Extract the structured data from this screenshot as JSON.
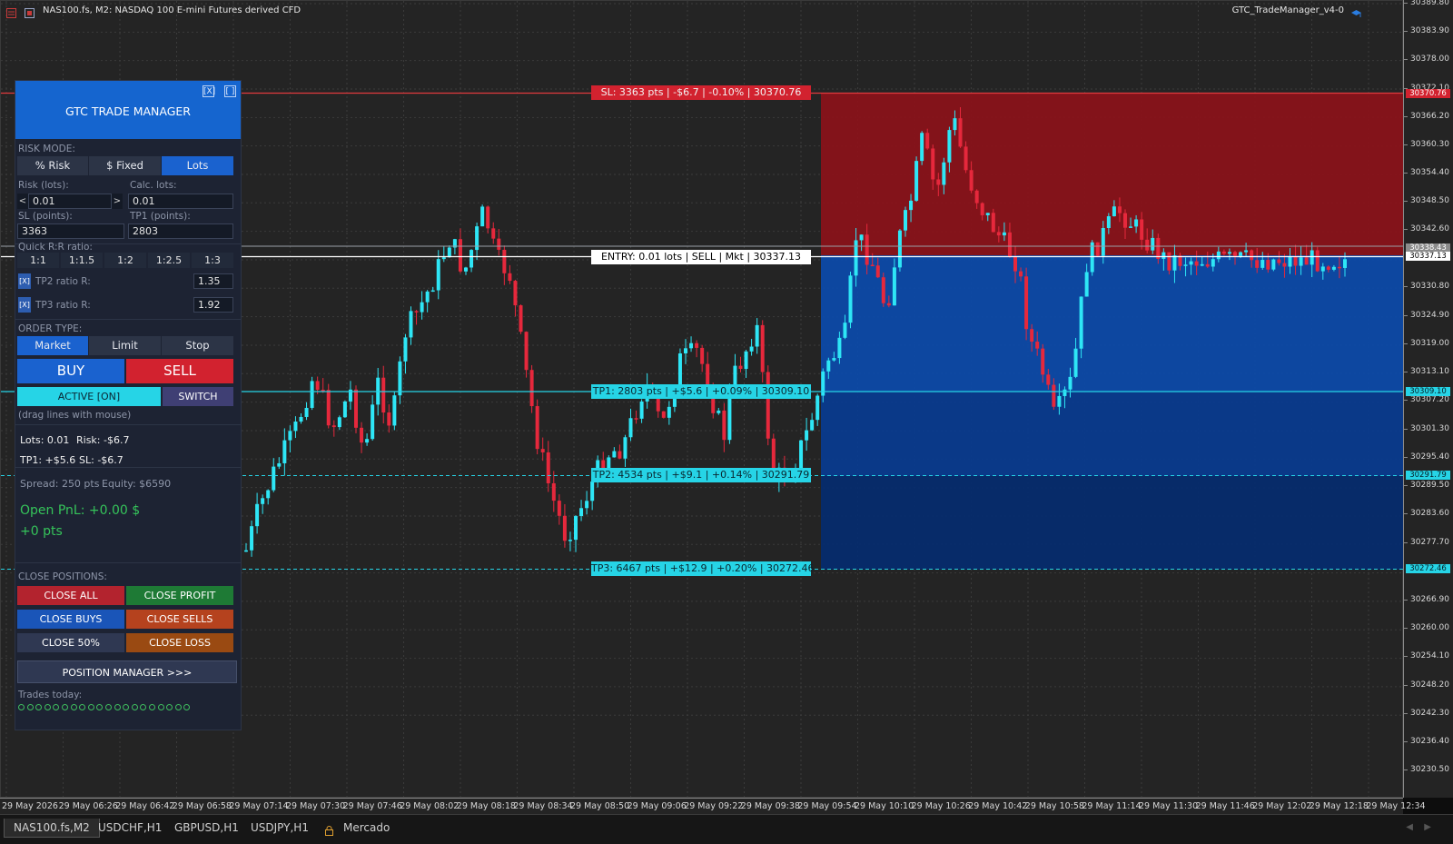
{
  "chart": {
    "title": "NAS100.fs, M2:  NASDAQ 100 E-mini Futures derived CFD",
    "ea_name": "GTC_TradeManager_v4-0"
  },
  "price_axis": {
    "labels": [
      "30389.80",
      "30383.90",
      "30378.00",
      "30372.10",
      "30366.20",
      "30360.30",
      "30354.40",
      "30348.50",
      "30342.60",
      "30330.80",
      "30324.90",
      "30319.00",
      "30313.10",
      "30307.20",
      "30301.30",
      "30295.40",
      "30289.50",
      "30283.60",
      "30277.70",
      "30266.90",
      "30260.00",
      "30254.10",
      "30248.20",
      "30242.30",
      "30236.40",
      "30230.50"
    ],
    "tag_sl": "30370.76",
    "tag_entry_a": "30338.43",
    "tag_entry_b": "30337.13",
    "tag_tp1": "30309.10",
    "tag_tp2": "30291.79",
    "tag_tp3": "30272.46"
  },
  "time_axis": {
    "labels": [
      "29 May 2026",
      "29 May 06:26",
      "29 May 06:42",
      "29 May 06:58",
      "29 May 07:14",
      "29 May 07:30",
      "29 May 07:46",
      "29 May 08:02",
      "29 May 08:18",
      "29 May 08:34",
      "29 May 08:50",
      "29 May 09:06",
      "29 May 09:22",
      "29 May 09:38",
      "29 May 09:54",
      "29 May 10:10",
      "29 May 10:26",
      "29 May 10:42",
      "29 May 10:58",
      "29 May 11:14",
      "29 May 11:30",
      "29 May 11:46",
      "29 May 12:02",
      "29 May 12:18",
      "29 May 12:34"
    ]
  },
  "lines": {
    "sl": "SL: 3363 pts | -$6.7 | -0.10% | 30370.76",
    "entry": "ENTRY: 0.01 lots | SELL | Mkt | 30337.13",
    "tp1": "TP1: 2803 pts | +$5.6 | +0.09% | 30309.10",
    "tp2": "TP2: 4534 pts | +$9.1 | +0.14% | 30291.79",
    "tp3": "TP3: 6467 pts | +$12.9 | +0.20% | 30272.46"
  },
  "colors": {
    "sl": "#e03a3e",
    "tp": "#26d4e6",
    "entry": "#ffffff",
    "bull": "#2ee6f6",
    "bear": "#e6283c",
    "panel_header": "#1565cf"
  },
  "panel": {
    "title": "GTC TRADE MANAGER",
    "header_btn_1": "[X]",
    "header_btn_2": "[ ]",
    "risk_mode_label": "RISK MODE:",
    "risk_modes": [
      "% Risk",
      "$ Fixed",
      "Lots"
    ],
    "risk_label": "Risk (lots):",
    "risk_value": "0.01",
    "dec": "<",
    "inc": ">",
    "calc_lots_label": "Calc. lots:",
    "calc_lots_value": "0.01",
    "sl_label": "SL (points):",
    "sl_value": "3363",
    "tp1_label": "TP1 (points):",
    "tp1_value": "2803",
    "rr_label": "Quick R:R ratio:",
    "rr_options": [
      "1:1",
      "1:1.5",
      "1:2",
      "1:2.5",
      "1:3"
    ],
    "tp2_check": "[X]",
    "tp2_ratio_label": "TP2 ratio R:",
    "tp2_ratio_value": "1.35",
    "tp3_check": "[X]",
    "tp3_ratio_label": "TP3 ratio R:",
    "tp3_ratio_value": "1.92",
    "order_type_label": "ORDER TYPE:",
    "order_types": [
      "Market",
      "Limit",
      "Stop"
    ],
    "buy": "BUY",
    "sell": "SELL",
    "active": "ACTIVE [ON]",
    "switch": "SWITCH",
    "drag_hint": "(drag lines with mouse)",
    "lots_info": "Lots: 0.01",
    "risk_info": "Risk: -$6.7",
    "tp1_info": "TP1: +$5.6",
    "sl_info": "SL: -$6.7",
    "spread_info": "Spread: 250 pts",
    "equity_info": "Equity: $6590",
    "open_pnl": "Open PnL: +0.00 $",
    "open_pts": "+0 pts",
    "close_label": "CLOSE POSITIONS:",
    "close_all": "CLOSE ALL",
    "close_profit": "CLOSE PROFIT",
    "close_buys": "CLOSE BUYS",
    "close_sells": "CLOSE SELLS",
    "close_50": "CLOSE 50%",
    "close_loss": "CLOSE LOSS",
    "position_manager": "POSITION MANAGER  >>>",
    "trades_today_label": "Trades today:",
    "trades_slots": 20
  },
  "tabs": [
    "NAS100.fs,M2",
    "USDCHF,H1",
    "GBPUSD,H1",
    "USDJPY,H1",
    "Mercado"
  ]
}
